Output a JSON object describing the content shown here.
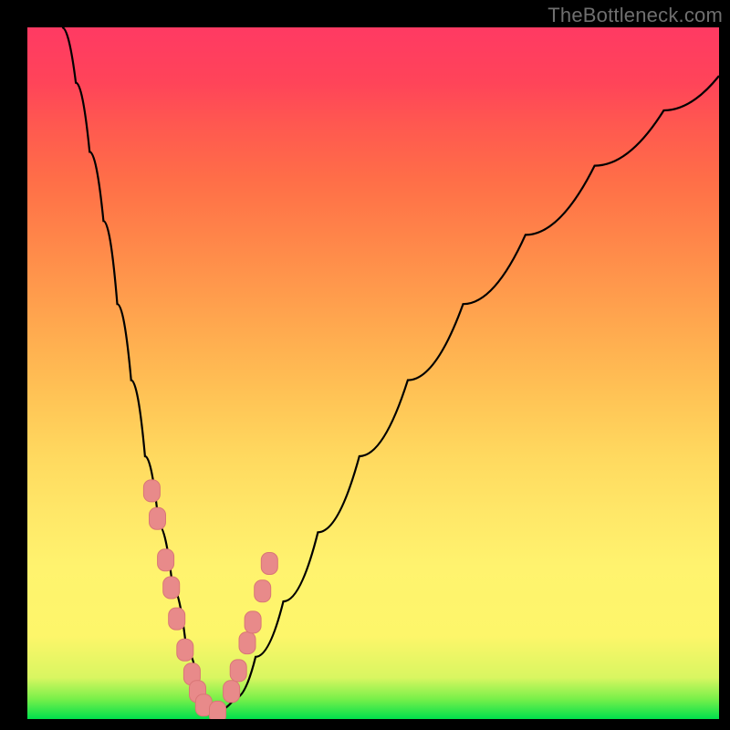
{
  "watermark": "TheBottleneck.com",
  "colors": {
    "background": "#000000",
    "curve": "#000000",
    "marker_fill": "#e88a8a",
    "marker_stroke": "#d97676"
  },
  "chart_data": {
    "type": "line",
    "title": "",
    "xlabel": "",
    "ylabel": "",
    "xlim": [
      0,
      100
    ],
    "ylim": [
      0,
      100
    ],
    "grid": false,
    "note": "Axes are unlabeled in the source image; values are in percent of plot area. The black curve is a V-shaped bottleneck curve: left branch falls steeply to a minimum around x≈25%, right branch rises more slowly toward ~100% at the right edge.",
    "series": [
      {
        "name": "bottleneck-curve",
        "x": [
          5,
          7,
          9,
          11,
          13,
          15,
          17,
          19,
          21,
          23,
          25,
          27,
          30,
          33,
          37,
          42,
          48,
          55,
          63,
          72,
          82,
          92,
          100
        ],
        "y": [
          100,
          92,
          82,
          72,
          60,
          49,
          38,
          28,
          19,
          10,
          3,
          1,
          3,
          9,
          17,
          27,
          38,
          49,
          60,
          70,
          80,
          88,
          93
        ]
      }
    ],
    "markers": {
      "name": "cluster-near-minimum",
      "shape": "rounded-rect",
      "points": [
        {
          "x": 18.0,
          "y": 33.0
        },
        {
          "x": 18.8,
          "y": 29.0
        },
        {
          "x": 20.0,
          "y": 23.0
        },
        {
          "x": 20.8,
          "y": 19.0
        },
        {
          "x": 21.6,
          "y": 14.5
        },
        {
          "x": 22.8,
          "y": 10.0
        },
        {
          "x": 23.8,
          "y": 6.5
        },
        {
          "x": 24.6,
          "y": 4.0
        },
        {
          "x": 25.5,
          "y": 2.0
        },
        {
          "x": 27.5,
          "y": 1.0
        },
        {
          "x": 29.5,
          "y": 4.0
        },
        {
          "x": 30.5,
          "y": 7.0
        },
        {
          "x": 31.8,
          "y": 11.0
        },
        {
          "x": 32.6,
          "y": 14.0
        },
        {
          "x": 34.0,
          "y": 18.5
        },
        {
          "x": 35.0,
          "y": 22.5
        }
      ]
    }
  }
}
